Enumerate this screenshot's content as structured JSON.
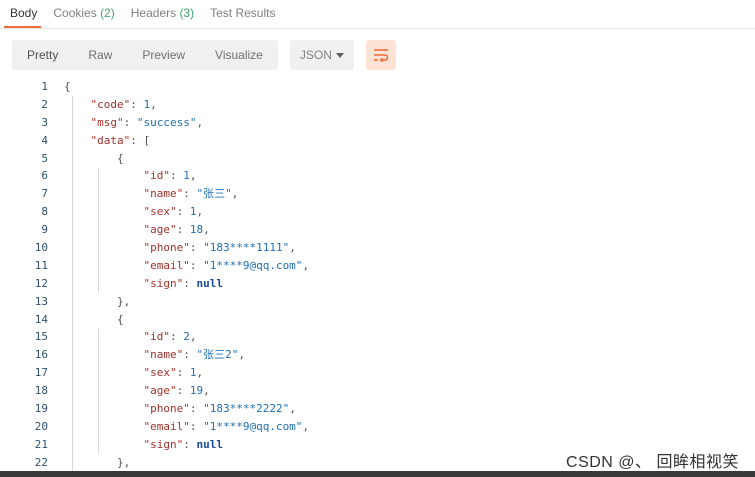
{
  "tabs": [
    {
      "label": "Body",
      "count": ""
    },
    {
      "label": "Cookies",
      "count": "(2)"
    },
    {
      "label": "Headers",
      "count": "(3)"
    },
    {
      "label": "Test Results",
      "count": ""
    }
  ],
  "toolbar": {
    "views": [
      "Pretty",
      "Raw",
      "Preview",
      "Visualize"
    ],
    "format": "JSON",
    "wrap_icon": "wrap-lines-icon",
    "accent": "#f26b3a"
  },
  "editor": {
    "lines": [
      [
        {
          "t": "p",
          "v": "{"
        }
      ],
      [
        {
          "t": "p",
          "v": "    "
        },
        {
          "t": "k",
          "v": "\"code\""
        },
        {
          "t": "p",
          "v": ": "
        },
        {
          "t": "n",
          "v": "1"
        },
        {
          "t": "p",
          "v": ","
        }
      ],
      [
        {
          "t": "p",
          "v": "    "
        },
        {
          "t": "k",
          "v": "\"msg\""
        },
        {
          "t": "p",
          "v": ": "
        },
        {
          "t": "s",
          "v": "\"success\""
        },
        {
          "t": "p",
          "v": ","
        }
      ],
      [
        {
          "t": "p",
          "v": "    "
        },
        {
          "t": "k",
          "v": "\"data\""
        },
        {
          "t": "p",
          "v": ": ["
        }
      ],
      [
        {
          "t": "p",
          "v": "        {"
        }
      ],
      [
        {
          "t": "p",
          "v": "            "
        },
        {
          "t": "k",
          "v": "\"id\""
        },
        {
          "t": "p",
          "v": ": "
        },
        {
          "t": "n",
          "v": "1"
        },
        {
          "t": "p",
          "v": ","
        }
      ],
      [
        {
          "t": "p",
          "v": "            "
        },
        {
          "t": "k",
          "v": "\"name\""
        },
        {
          "t": "p",
          "v": ": "
        },
        {
          "t": "s",
          "v": "\"张三\""
        },
        {
          "t": "p",
          "v": ","
        }
      ],
      [
        {
          "t": "p",
          "v": "            "
        },
        {
          "t": "k",
          "v": "\"sex\""
        },
        {
          "t": "p",
          "v": ": "
        },
        {
          "t": "n",
          "v": "1"
        },
        {
          "t": "p",
          "v": ","
        }
      ],
      [
        {
          "t": "p",
          "v": "            "
        },
        {
          "t": "k",
          "v": "\"age\""
        },
        {
          "t": "p",
          "v": ": "
        },
        {
          "t": "n",
          "v": "18"
        },
        {
          "t": "p",
          "v": ","
        }
      ],
      [
        {
          "t": "p",
          "v": "            "
        },
        {
          "t": "k",
          "v": "\"phone\""
        },
        {
          "t": "p",
          "v": ": "
        },
        {
          "t": "s",
          "v": "\"183****1111\""
        },
        {
          "t": "p",
          "v": ","
        }
      ],
      [
        {
          "t": "p",
          "v": "            "
        },
        {
          "t": "k",
          "v": "\"email\""
        },
        {
          "t": "p",
          "v": ": "
        },
        {
          "t": "s",
          "v": "\"1****9@qq.com\""
        },
        {
          "t": "p",
          "v": ","
        }
      ],
      [
        {
          "t": "p",
          "v": "            "
        },
        {
          "t": "k",
          "v": "\"sign\""
        },
        {
          "t": "p",
          "v": ": "
        },
        {
          "t": "kw",
          "v": "null"
        }
      ],
      [
        {
          "t": "p",
          "v": "        },"
        }
      ],
      [
        {
          "t": "p",
          "v": "        {"
        }
      ],
      [
        {
          "t": "p",
          "v": "            "
        },
        {
          "t": "k",
          "v": "\"id\""
        },
        {
          "t": "p",
          "v": ": "
        },
        {
          "t": "n",
          "v": "2"
        },
        {
          "t": "p",
          "v": ","
        }
      ],
      [
        {
          "t": "p",
          "v": "            "
        },
        {
          "t": "k",
          "v": "\"name\""
        },
        {
          "t": "p",
          "v": ": "
        },
        {
          "t": "s",
          "v": "\"张三2\""
        },
        {
          "t": "p",
          "v": ","
        }
      ],
      [
        {
          "t": "p",
          "v": "            "
        },
        {
          "t": "k",
          "v": "\"sex\""
        },
        {
          "t": "p",
          "v": ": "
        },
        {
          "t": "n",
          "v": "1"
        },
        {
          "t": "p",
          "v": ","
        }
      ],
      [
        {
          "t": "p",
          "v": "            "
        },
        {
          "t": "k",
          "v": "\"age\""
        },
        {
          "t": "p",
          "v": ": "
        },
        {
          "t": "n",
          "v": "19"
        },
        {
          "t": "p",
          "v": ","
        }
      ],
      [
        {
          "t": "p",
          "v": "            "
        },
        {
          "t": "k",
          "v": "\"phone\""
        },
        {
          "t": "p",
          "v": ": "
        },
        {
          "t": "s",
          "v": "\"183****2222\""
        },
        {
          "t": "p",
          "v": ","
        }
      ],
      [
        {
          "t": "p",
          "v": "            "
        },
        {
          "t": "k",
          "v": "\"email\""
        },
        {
          "t": "p",
          "v": ": "
        },
        {
          "t": "s",
          "v": "\"1****9@qq.com\""
        },
        {
          "t": "p",
          "v": ","
        }
      ],
      [
        {
          "t": "p",
          "v": "            "
        },
        {
          "t": "k",
          "v": "\"sign\""
        },
        {
          "t": "p",
          "v": ": "
        },
        {
          "t": "kw",
          "v": "null"
        }
      ],
      [
        {
          "t": "p",
          "v": "        },"
        }
      ]
    ]
  },
  "watermark": "CSDN @、  回眸相视笑"
}
